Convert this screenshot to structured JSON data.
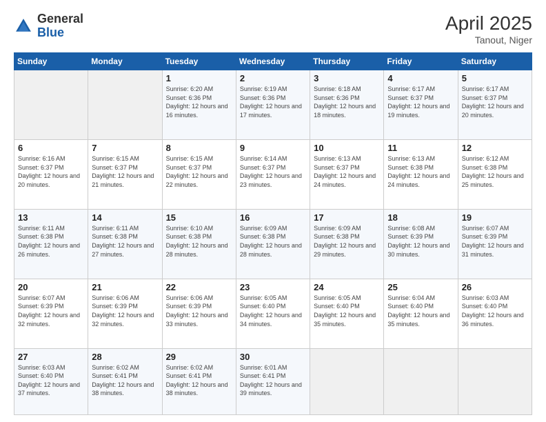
{
  "header": {
    "logo_general": "General",
    "logo_blue": "Blue",
    "month_title": "April 2025",
    "location": "Tanout, Niger"
  },
  "weekdays": [
    "Sunday",
    "Monday",
    "Tuesday",
    "Wednesday",
    "Thursday",
    "Friday",
    "Saturday"
  ],
  "weeks": [
    [
      {
        "day": "",
        "empty": true
      },
      {
        "day": "",
        "empty": true
      },
      {
        "day": "1",
        "sunrise": "6:20 AM",
        "sunset": "6:36 PM",
        "daylight": "12 hours and 16 minutes."
      },
      {
        "day": "2",
        "sunrise": "6:19 AM",
        "sunset": "6:36 PM",
        "daylight": "12 hours and 17 minutes."
      },
      {
        "day": "3",
        "sunrise": "6:18 AM",
        "sunset": "6:36 PM",
        "daylight": "12 hours and 18 minutes."
      },
      {
        "day": "4",
        "sunrise": "6:17 AM",
        "sunset": "6:37 PM",
        "daylight": "12 hours and 19 minutes."
      },
      {
        "day": "5",
        "sunrise": "6:17 AM",
        "sunset": "6:37 PM",
        "daylight": "12 hours and 20 minutes."
      }
    ],
    [
      {
        "day": "6",
        "sunrise": "6:16 AM",
        "sunset": "6:37 PM",
        "daylight": "12 hours and 20 minutes."
      },
      {
        "day": "7",
        "sunrise": "6:15 AM",
        "sunset": "6:37 PM",
        "daylight": "12 hours and 21 minutes."
      },
      {
        "day": "8",
        "sunrise": "6:15 AM",
        "sunset": "6:37 PM",
        "daylight": "12 hours and 22 minutes."
      },
      {
        "day": "9",
        "sunrise": "6:14 AM",
        "sunset": "6:37 PM",
        "daylight": "12 hours and 23 minutes."
      },
      {
        "day": "10",
        "sunrise": "6:13 AM",
        "sunset": "6:37 PM",
        "daylight": "12 hours and 24 minutes."
      },
      {
        "day": "11",
        "sunrise": "6:13 AM",
        "sunset": "6:38 PM",
        "daylight": "12 hours and 24 minutes."
      },
      {
        "day": "12",
        "sunrise": "6:12 AM",
        "sunset": "6:38 PM",
        "daylight": "12 hours and 25 minutes."
      }
    ],
    [
      {
        "day": "13",
        "sunrise": "6:11 AM",
        "sunset": "6:38 PM",
        "daylight": "12 hours and 26 minutes."
      },
      {
        "day": "14",
        "sunrise": "6:11 AM",
        "sunset": "6:38 PM",
        "daylight": "12 hours and 27 minutes."
      },
      {
        "day": "15",
        "sunrise": "6:10 AM",
        "sunset": "6:38 PM",
        "daylight": "12 hours and 28 minutes."
      },
      {
        "day": "16",
        "sunrise": "6:09 AM",
        "sunset": "6:38 PM",
        "daylight": "12 hours and 28 minutes."
      },
      {
        "day": "17",
        "sunrise": "6:09 AM",
        "sunset": "6:38 PM",
        "daylight": "12 hours and 29 minutes."
      },
      {
        "day": "18",
        "sunrise": "6:08 AM",
        "sunset": "6:39 PM",
        "daylight": "12 hours and 30 minutes."
      },
      {
        "day": "19",
        "sunrise": "6:07 AM",
        "sunset": "6:39 PM",
        "daylight": "12 hours and 31 minutes."
      }
    ],
    [
      {
        "day": "20",
        "sunrise": "6:07 AM",
        "sunset": "6:39 PM",
        "daylight": "12 hours and 32 minutes."
      },
      {
        "day": "21",
        "sunrise": "6:06 AM",
        "sunset": "6:39 PM",
        "daylight": "12 hours and 32 minutes."
      },
      {
        "day": "22",
        "sunrise": "6:06 AM",
        "sunset": "6:39 PM",
        "daylight": "12 hours and 33 minutes."
      },
      {
        "day": "23",
        "sunrise": "6:05 AM",
        "sunset": "6:40 PM",
        "daylight": "12 hours and 34 minutes."
      },
      {
        "day": "24",
        "sunrise": "6:05 AM",
        "sunset": "6:40 PM",
        "daylight": "12 hours and 35 minutes."
      },
      {
        "day": "25",
        "sunrise": "6:04 AM",
        "sunset": "6:40 PM",
        "daylight": "12 hours and 35 minutes."
      },
      {
        "day": "26",
        "sunrise": "6:03 AM",
        "sunset": "6:40 PM",
        "daylight": "12 hours and 36 minutes."
      }
    ],
    [
      {
        "day": "27",
        "sunrise": "6:03 AM",
        "sunset": "6:40 PM",
        "daylight": "12 hours and 37 minutes."
      },
      {
        "day": "28",
        "sunrise": "6:02 AM",
        "sunset": "6:41 PM",
        "daylight": "12 hours and 38 minutes."
      },
      {
        "day": "29",
        "sunrise": "6:02 AM",
        "sunset": "6:41 PM",
        "daylight": "12 hours and 38 minutes."
      },
      {
        "day": "30",
        "sunrise": "6:01 AM",
        "sunset": "6:41 PM",
        "daylight": "12 hours and 39 minutes."
      },
      {
        "day": "",
        "empty": true
      },
      {
        "day": "",
        "empty": true
      },
      {
        "day": "",
        "empty": true
      }
    ]
  ],
  "labels": {
    "sunrise": "Sunrise:",
    "sunset": "Sunset:",
    "daylight": "Daylight:"
  }
}
